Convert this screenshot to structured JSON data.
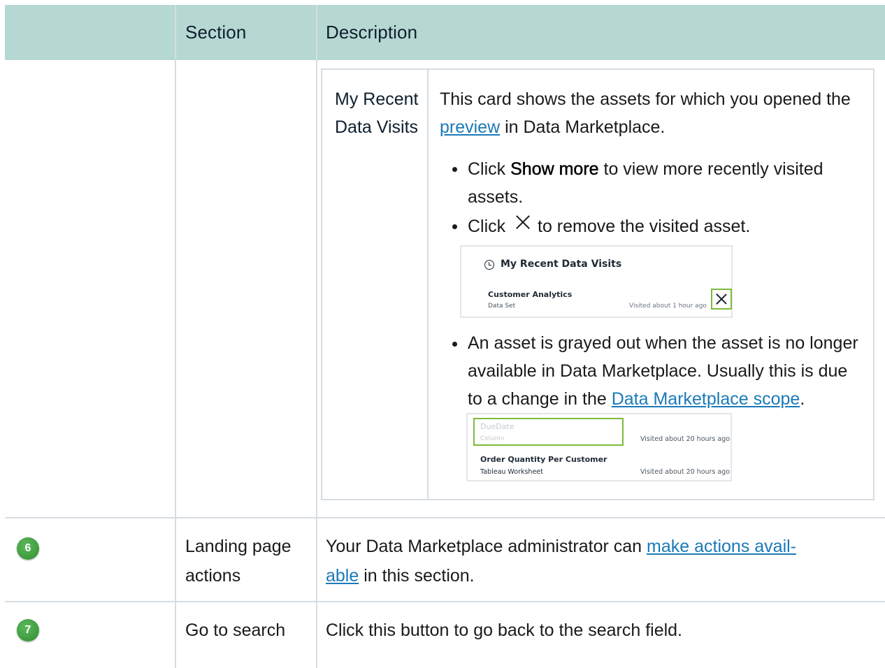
{
  "header": {
    "col_section": "Section",
    "col_description": "Description"
  },
  "row_recent": {
    "card_name_line1": "My Recent",
    "card_name_line2": "Data Visits",
    "desc_line1": "This card shows the assets for which you opened the",
    "desc_link_preview": "preview",
    "desc_line2_rest": " in Data Marketplace.",
    "bullet1_pre": "Click ",
    "bullet1_bold": "Show more",
    "bullet1_post": " to view more recently visited",
    "bullet1_line2": "assets.",
    "bullet2_pre": "Click",
    "bullet2_post": "to remove the visited asset.",
    "bullet3_line1": "An asset is grayed out when the asset is no longer",
    "bullet3_line2": "available in Data Marketplace. Usually this is due",
    "bullet3_line3_pre": "to a change in the ",
    "bullet3_link": "Data Marketplace scope",
    "bullet3_line3_post": ".",
    "shot1": {
      "title": "My Recent Data Visits",
      "asset_name": "Customer Analytics",
      "asset_type": "Data Set",
      "visited": "Visited about 1 hour ago"
    },
    "shot2": {
      "asset1_name": "DueDate",
      "asset1_type": "Column",
      "asset1_visited": "Visited about 20 hours ago",
      "asset2_name": "Order Quantity Per Customer",
      "asset2_type": "Tableau Worksheet",
      "asset2_visited": "Visited about 20 hours ago"
    }
  },
  "row6": {
    "badge": "6",
    "section_line1": "Landing page",
    "section_line2": "actions",
    "desc_line1_pre": "Your Data Marketplace administrator can ",
    "desc_link_line1": "make actions avail-",
    "desc_link_line2": "able",
    "desc_line2_post": " in this section."
  },
  "row7": {
    "badge": "7",
    "section": "Go to search",
    "desc": "Click this button to go back to the search field."
  }
}
